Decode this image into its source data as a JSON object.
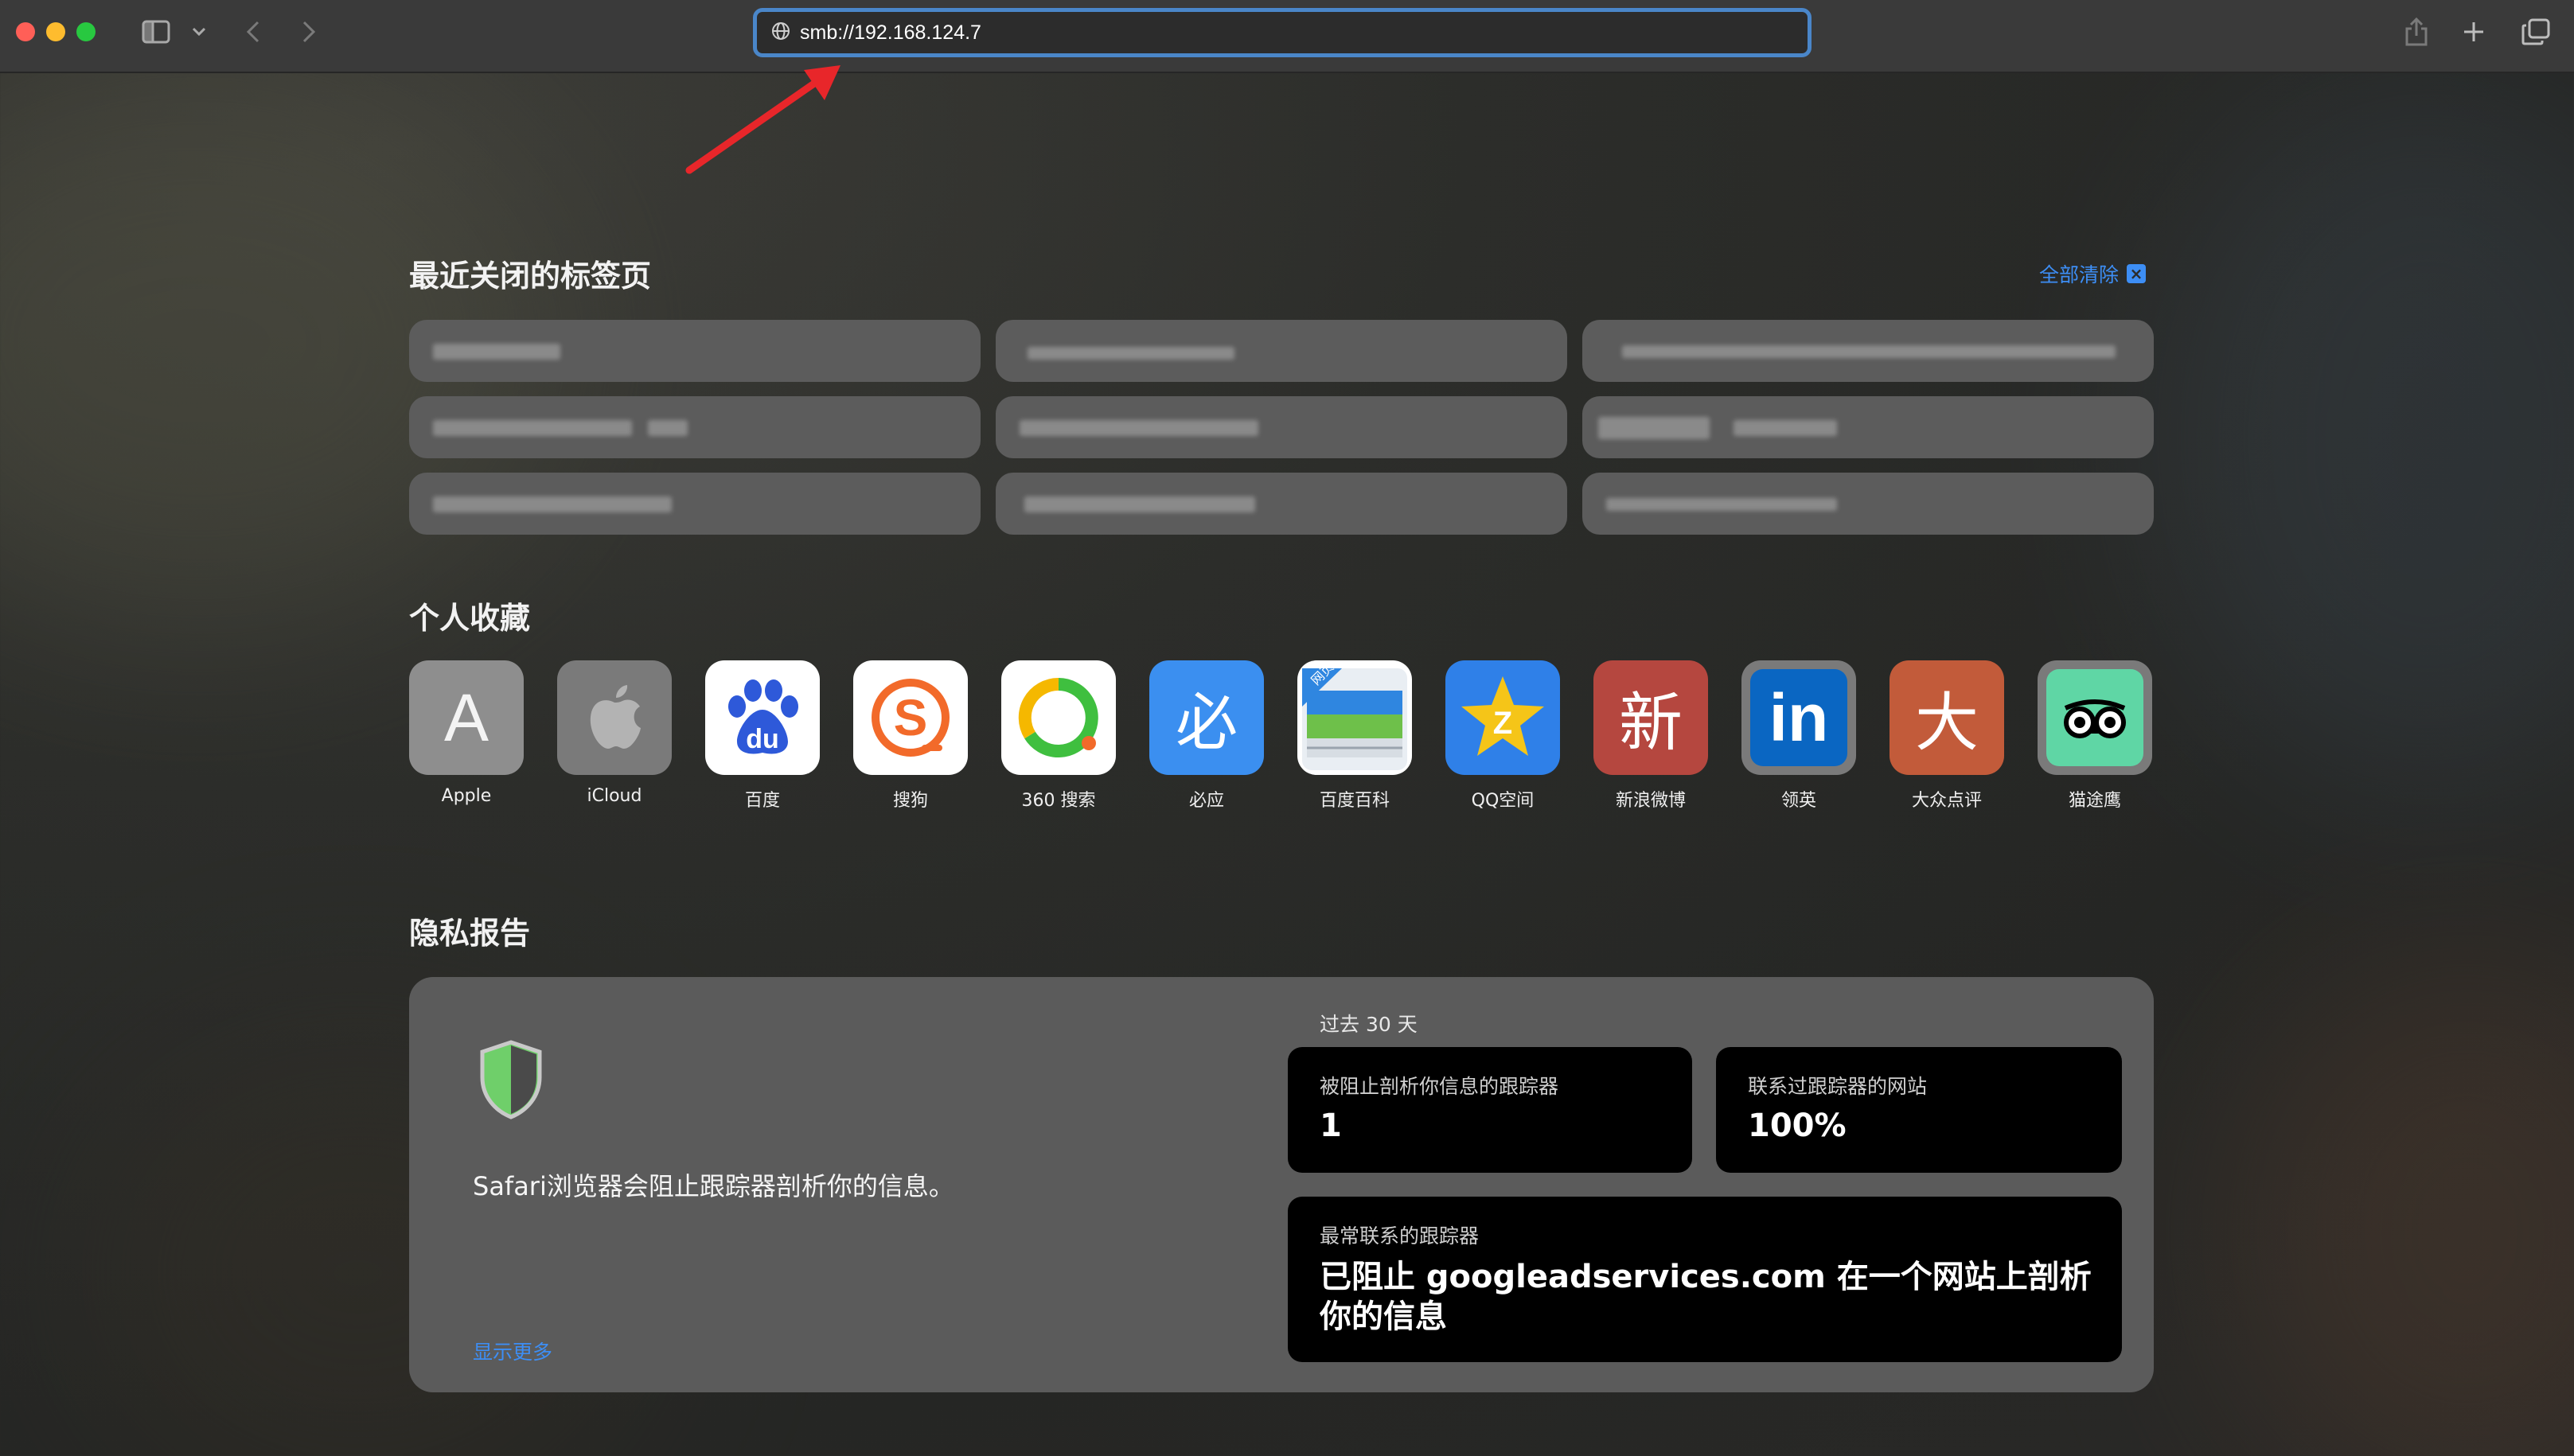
{
  "toolbar": {
    "url": "smb://192.168.124.7"
  },
  "recent": {
    "title": "最近关闭的标签页",
    "clear_label": "全部清除"
  },
  "favorites": {
    "title": "个人收藏",
    "items": [
      {
        "label": "Apple",
        "glyph": "A",
        "color": "#8e8e8e"
      },
      {
        "label": "iCloud",
        "glyph": "",
        "color": "#7a7a7a"
      },
      {
        "label": "百度",
        "glyph": "du",
        "color": "#ffffff"
      },
      {
        "label": "搜狗",
        "glyph": "S",
        "color": "#ffffff"
      },
      {
        "label": "360 搜索",
        "glyph": "",
        "color": "#ffffff"
      },
      {
        "label": "必应",
        "glyph": "必",
        "color": "#3b8ff0"
      },
      {
        "label": "百度百科",
        "glyph": "网页",
        "color": "#ffffff"
      },
      {
        "label": "QQ空间",
        "glyph": "Z",
        "color": "#2f80e8"
      },
      {
        "label": "新浪微博",
        "glyph": "新",
        "color": "#b5473f"
      },
      {
        "label": "领英",
        "glyph": "in",
        "color": "#0a66c2"
      },
      {
        "label": "大众点评",
        "glyph": "大",
        "color": "#c25b3a"
      },
      {
        "label": "猫途鹰",
        "glyph": "",
        "color": "#5fd6a5"
      }
    ]
  },
  "privacy": {
    "title": "隐私报告",
    "description": "Safari浏览器会阻止跟踪器剖析你的信息。",
    "show_more": "显示更多",
    "period": "过去 30 天",
    "blocked_caption": "被阻止剖析你信息的跟踪器",
    "blocked_value": "1",
    "sites_caption": "联系过跟踪器的网站",
    "sites_value": "100%",
    "top_caption": "最常联系的跟踪器",
    "top_value": "已阻止 googleadservices.com 在一个网站上剖析你的信息"
  },
  "colors": {
    "accent": "#3d8ef5",
    "address_border": "#4a86c9",
    "annotation_arrow": "#e8262a"
  },
  "icons": [
    "sidebar-icon",
    "chevron-down-icon",
    "back-icon",
    "forward-icon",
    "globe-icon",
    "share-icon",
    "plus-icon",
    "tabs-overview-icon",
    "shield-icon",
    "close-box-icon"
  ]
}
